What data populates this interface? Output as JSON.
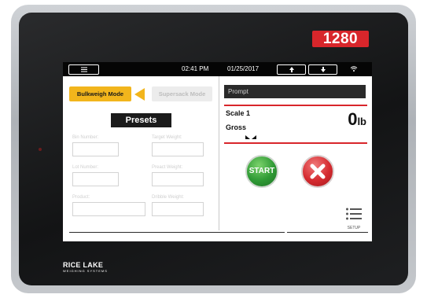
{
  "device": {
    "model": "1280",
    "brand": "RICE LAKE",
    "brand_sub": "WEIGHING SYSTEMS"
  },
  "status_bar": {
    "menu_icon": "hamburger-icon",
    "time": "02:41 PM",
    "date": "01/25/2017",
    "up_icon": "arrow-up-icon",
    "down_icon": "arrow-down-icon",
    "wifi_icon": "wifi-icon"
  },
  "left_panel": {
    "mode_active": "Bulkweigh Mode",
    "mode_inactive": "Supersack Mode",
    "presets_title": "Presets",
    "fields": {
      "bin_number": {
        "label": "Bin Number:",
        "value": ""
      },
      "target_weight": {
        "label": "Target Weight:",
        "value": ""
      },
      "lot_number": {
        "label": "Lot Number:",
        "value": ""
      },
      "preact_weight": {
        "label": "Preact Weight:",
        "value": ""
      },
      "product": {
        "label": "Product:",
        "value": ""
      },
      "dribble_weight": {
        "label": "Dribble Weight:",
        "value": ""
      }
    }
  },
  "right_panel": {
    "prompt": "Prompt",
    "scale_name": "Scale 1",
    "weigh_mode": "Gross",
    "weight_value": "0",
    "weight_unit": "lb",
    "start_label": "START",
    "setup_label": "SETUP"
  },
  "colors": {
    "accent_yellow": "#f2b51c",
    "accent_red": "#d8262b",
    "start_green": "#2f9a35"
  }
}
